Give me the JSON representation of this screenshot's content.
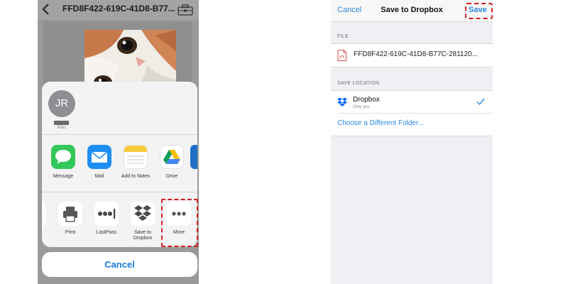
{
  "left": {
    "nav_title": "FFD8F422-619C-41D8-B77...",
    "airdrop": {
      "initials": "JR",
      "device": "iMac"
    },
    "apps": [
      {
        "label": "Message",
        "icon": "messages-icon"
      },
      {
        "label": "Mail",
        "icon": "mail-icon"
      },
      {
        "label": "Add to Notes",
        "icon": "notes-icon"
      },
      {
        "label": "Drive",
        "icon": "google-drive-icon"
      }
    ],
    "actions": [
      {
        "label": "Print",
        "icon": "printer-icon"
      },
      {
        "label": "LastPass",
        "icon": "lastpass-icon"
      },
      {
        "label": "Save to Dropbox",
        "icon": "dropbox-icon"
      },
      {
        "label": "More",
        "icon": "more-icon"
      }
    ],
    "cancel": "Cancel"
  },
  "right": {
    "nav": {
      "cancel": "Cancel",
      "title": "Save to Dropbox",
      "save": "Save"
    },
    "file_header": "FILE",
    "file_name": "FFD8F422-619C-41D8-B77C-281120...",
    "location_header": "SAVE LOCATION",
    "location": {
      "name": "Dropbox",
      "subtitle": "Only you"
    },
    "choose_folder": "Choose a Different Folder..."
  },
  "colors": {
    "accent": "#2a88dc",
    "highlight": "#d41f1f",
    "dropbox": "#0061fe"
  }
}
